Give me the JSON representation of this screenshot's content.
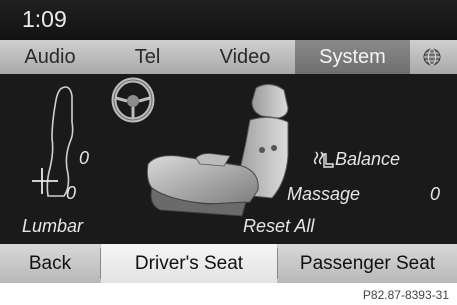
{
  "status": {
    "time": "1:09"
  },
  "tabs": [
    {
      "label": "Audio"
    },
    {
      "label": "Tel"
    },
    {
      "label": "Video"
    },
    {
      "label": "System",
      "active": true
    }
  ],
  "seat": {
    "lumbar_label": "Lumbar",
    "lumbar_upper_value": "0",
    "lumbar_lower_value": "0",
    "balance_label": "Balance",
    "massage_label": "Massage",
    "massage_value": "0",
    "reset_label": "Reset All"
  },
  "bottom_buttons": [
    {
      "label": "Back"
    },
    {
      "label": "Driver's Seat",
      "selected": true
    },
    {
      "label": "Passenger Seat"
    }
  ],
  "figure_code": "P82.87-8393-31",
  "colors": {
    "screen_bg": "#151515",
    "tab_active": "#7a7a7a",
    "button_selected": "#f0f0f0"
  }
}
